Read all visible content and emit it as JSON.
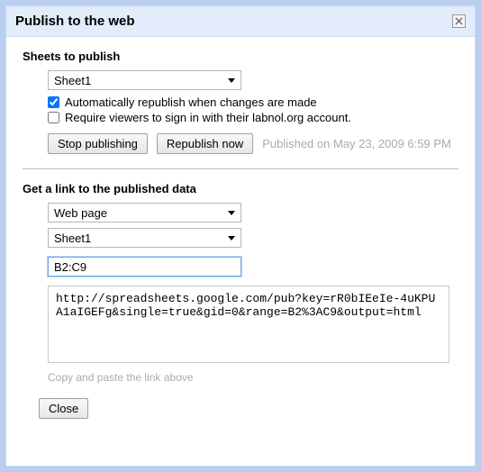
{
  "title": "Publish to the web",
  "section1": {
    "heading": "Sheets to publish",
    "sheet_select": "Sheet1",
    "auto_republish_label": "Automatically republish when changes are made",
    "auto_republish_checked": true,
    "require_signin_label": "Require viewers to sign in with their labnol.org account.",
    "require_signin_checked": false,
    "stop_btn": "Stop publishing",
    "republish_btn": "Republish now",
    "published_status": "Published on May 23, 2009 6:59 PM"
  },
  "section2": {
    "heading": "Get a link to the published data",
    "format_select": "Web page",
    "sheet_select": "Sheet1",
    "range_value": "B2:C9",
    "url": "http://spreadsheets.google.com/pub?key=rR0bIEeIe-4uKPUA1aIGEFg&single=true&gid=0&range=B2%3AC9&output=html",
    "helper": "Copy and paste the link above"
  },
  "close_btn": "Close"
}
